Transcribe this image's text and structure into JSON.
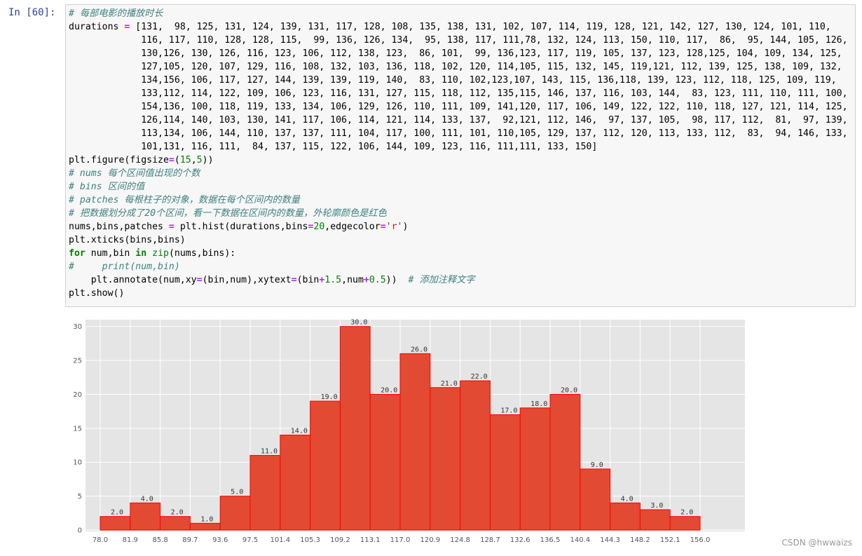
{
  "cell": {
    "prompt": "In [60]:",
    "code_lines": [
      [
        [
          "c",
          "# 每部电影的播放时长"
        ]
      ],
      [
        [
          "p",
          "durations "
        ],
        [
          "o",
          "="
        ],
        [
          "p",
          " [131,  98, 125, 131, 124, 139, 131, 117, 128, 108, 135, 138, 131, 102, 107, 114, 119, 128, 121, 142, 127, 130, 124, 101, 110,"
        ]
      ],
      [
        [
          "p",
          "             116, 117, 110, 128, 128, 115,  99, 136, 126, 134,  95, 138, 117, 111,78, 132, 124, 113, 150, 110, 117,  86,  95, 144, 105, 126,"
        ]
      ],
      [
        [
          "p",
          "             130,126, 130, 126, 116, 123, 106, 112, 138, 123,  86, 101,  99, 136,123, 117, 119, 105, 137, 123, 128,125, 104, 109, 134, 125,"
        ]
      ],
      [
        [
          "p",
          "             127,105, 120, 107, 129, 116, 108, 132, 103, 136, 118, 102, 120, 114,105, 115, 132, 145, 119,121, 112, 139, 125, 138, 109, 132,"
        ]
      ],
      [
        [
          "p",
          "             134,156, 106, 117, 127, 144, 139, 139, 119, 140,  83, 110, 102,123,107, 143, 115, 136,118, 139, 123, 112, 118, 125, 109, 119,"
        ]
      ],
      [
        [
          "p",
          "             133,112, 114, 122, 109, 106, 123, 116, 131, 127, 115, 118, 112, 135,115, 146, 137, 116, 103, 144,  83, 123, 111, 110, 111, 100,"
        ]
      ],
      [
        [
          "p",
          "             154,136, 100, 118, 119, 133, 134, 106, 129, 126, 110, 111, 109, 141,120, 117, 106, 149, 122, 122, 110, 118, 127, 121, 114, 125,"
        ]
      ],
      [
        [
          "p",
          "             126,114, 140, 103, 130, 141, 117, 106, 114, 121, 114, 133, 137,  92,121, 112, 146,  97, 137, 105,  98, 117, 112,  81,  97, 139,"
        ]
      ],
      [
        [
          "p",
          "             113,134, 106, 144, 110, 137, 137, 111, 104, 117, 100, 111, 101, 110,105, 129, 137, 112, 120, 113, 133, 112,  83,  94, 146, 133,"
        ]
      ],
      [
        [
          "p",
          "             101,131, 116, 111,  84, 137, 115, 122, 106, 144, 109, 123, 116, 111,111, 133, 150]"
        ]
      ],
      [
        [
          "p",
          "plt.figure(figsize"
        ],
        [
          "o",
          "="
        ],
        [
          "p",
          "("
        ],
        [
          "n",
          "15"
        ],
        [
          "p",
          ","
        ],
        [
          "n",
          "5"
        ],
        [
          "p",
          "))"
        ]
      ],
      [
        [
          "c",
          "# nums 每个区间值出现的个数"
        ]
      ],
      [
        [
          "c",
          "# bins 区间的值"
        ]
      ],
      [
        [
          "c",
          "# patches 每根柱子的对象，数据在每个区间内的数量"
        ]
      ],
      [
        [
          "c",
          "# 把数据划分成了20个区间，看一下数据在区间内的数量，外轮廓颜色是红色"
        ]
      ],
      [
        [
          "p",
          "nums,bins,patches "
        ],
        [
          "o",
          "="
        ],
        [
          "p",
          " plt.hist(durations,bins"
        ],
        [
          "o",
          "="
        ],
        [
          "n",
          "20"
        ],
        [
          "p",
          ",edgecolor"
        ],
        [
          "o",
          "="
        ],
        [
          "s",
          "'r'"
        ],
        [
          "p",
          ")"
        ]
      ],
      [
        [
          "p",
          "plt.xticks(bins,bins)"
        ]
      ],
      [
        [
          "k",
          "for"
        ],
        [
          "p",
          " num,bin "
        ],
        [
          "k",
          "in"
        ],
        [
          "p",
          " "
        ],
        [
          "b",
          "zip"
        ],
        [
          "p",
          "(nums,bins):"
        ]
      ],
      [
        [
          "c",
          "#     print(num,bin)"
        ]
      ],
      [
        [
          "p",
          "    plt.annotate(num,xy"
        ],
        [
          "o",
          "="
        ],
        [
          "p",
          "(bin,num),xytext"
        ],
        [
          "o",
          "="
        ],
        [
          "p",
          "(bin"
        ],
        [
          "o",
          "+"
        ],
        [
          "n",
          "1.5"
        ],
        [
          "p",
          ",num"
        ],
        [
          "o",
          "+"
        ],
        [
          "n",
          "0.5"
        ],
        [
          "p",
          "))  "
        ],
        [
          "c",
          "# 添加注释文字"
        ]
      ],
      [
        [
          "p",
          "plt.show()"
        ]
      ]
    ]
  },
  "chart_data": {
    "type": "bar",
    "title": "",
    "xlabel": "",
    "ylabel": "",
    "bins": [
      "78.0",
      "81.9",
      "85.8",
      "89.7",
      "93.6",
      "97.5",
      "101.4",
      "105.3",
      "109.2",
      "113.1",
      "117.0",
      "120.9",
      "124.8",
      "128.7",
      "132.6",
      "136.5",
      "140.4",
      "144.3",
      "148.2",
      "152.1",
      "156.0"
    ],
    "values": [
      2,
      4,
      2,
      1,
      5,
      11,
      14,
      19,
      30,
      20,
      26,
      21,
      22,
      17,
      18,
      20,
      9,
      4,
      3,
      2
    ],
    "value_labels": [
      "2.0",
      "4.0",
      "2.0",
      "1.0",
      "5.0",
      "11.0",
      "14.0",
      "19.0",
      "30.0",
      "20.0",
      "26.0",
      "21.0",
      "22.0",
      "17.0",
      "18.0",
      "20.0",
      "9.0",
      "4.0",
      "3.0",
      "2.0"
    ],
    "yticks": [
      "0",
      "5",
      "10",
      "15",
      "20",
      "25",
      "30"
    ],
    "ylim": [
      0,
      31
    ],
    "grid": true,
    "colors": {
      "bar": "#e24a33",
      "edge": "#ff0000",
      "background": "#e5e5e5",
      "grid": "#ffffff",
      "tick_text": "#555555"
    }
  },
  "watermark": "CSDN @hwwaizs"
}
